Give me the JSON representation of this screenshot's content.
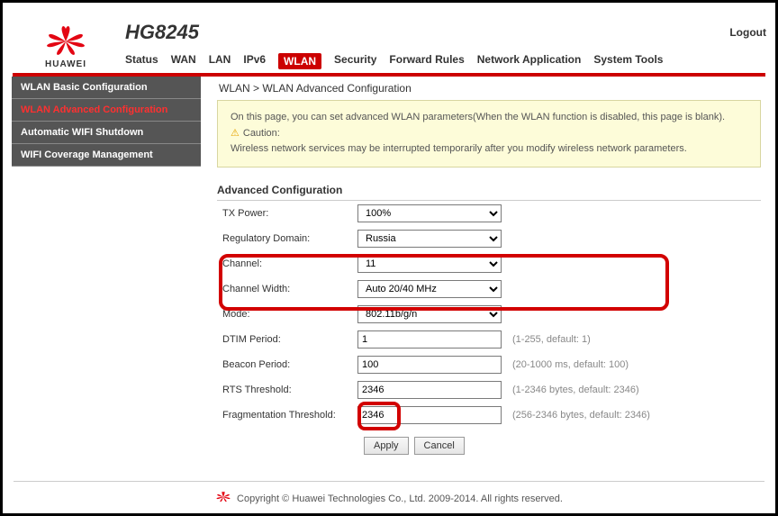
{
  "header": {
    "brand": "HUAWEI",
    "model": "HG8245",
    "logout": "Logout",
    "tabs": [
      "Status",
      "WAN",
      "LAN",
      "IPv6",
      "WLAN",
      "Security",
      "Forward Rules",
      "Network Application",
      "System Tools"
    ],
    "active_tab": "WLAN"
  },
  "sidebar": {
    "items": [
      {
        "label": "WLAN Basic Configuration"
      },
      {
        "label": "WLAN Advanced Configuration"
      },
      {
        "label": "Automatic WIFI Shutdown"
      },
      {
        "label": "WIFI Coverage Management"
      }
    ]
  },
  "breadcrumb": "WLAN > WLAN Advanced Configuration",
  "info": {
    "line1": "On this page, you can set advanced WLAN parameters(When the WLAN function is disabled, this page is blank).",
    "caution": "Caution:",
    "line2": "Wireless network services may be interrupted temporarily after you modify wireless network parameters."
  },
  "section_title": "Advanced Configuration",
  "rows": {
    "tx_power": {
      "label": "TX Power:",
      "value": "100%"
    },
    "reg_domain": {
      "label": "Regulatory Domain:",
      "value": "Russia"
    },
    "channel": {
      "label": "Channel:",
      "value": "11"
    },
    "channel_width": {
      "label": "Channel Width:",
      "value": "Auto 20/40 MHz"
    },
    "mode": {
      "label": "Mode:",
      "value": "802.11b/g/n"
    },
    "dtim": {
      "label": "DTIM Period:",
      "value": "1",
      "hint": "(1-255, default: 1)"
    },
    "beacon": {
      "label": "Beacon Period:",
      "value": "100",
      "hint": "(20-1000 ms, default: 100)"
    },
    "rts": {
      "label": "RTS Threshold:",
      "value": "2346",
      "hint": "(1-2346 bytes, default: 2346)"
    },
    "frag": {
      "label": "Fragmentation Threshold:",
      "value": "2346",
      "hint": "(256-2346 bytes, default: 2346)"
    }
  },
  "buttons": {
    "apply": "Apply",
    "cancel": "Cancel"
  },
  "footer": "Copyright © Huawei Technologies Co., Ltd. 2009-2014. All rights reserved."
}
